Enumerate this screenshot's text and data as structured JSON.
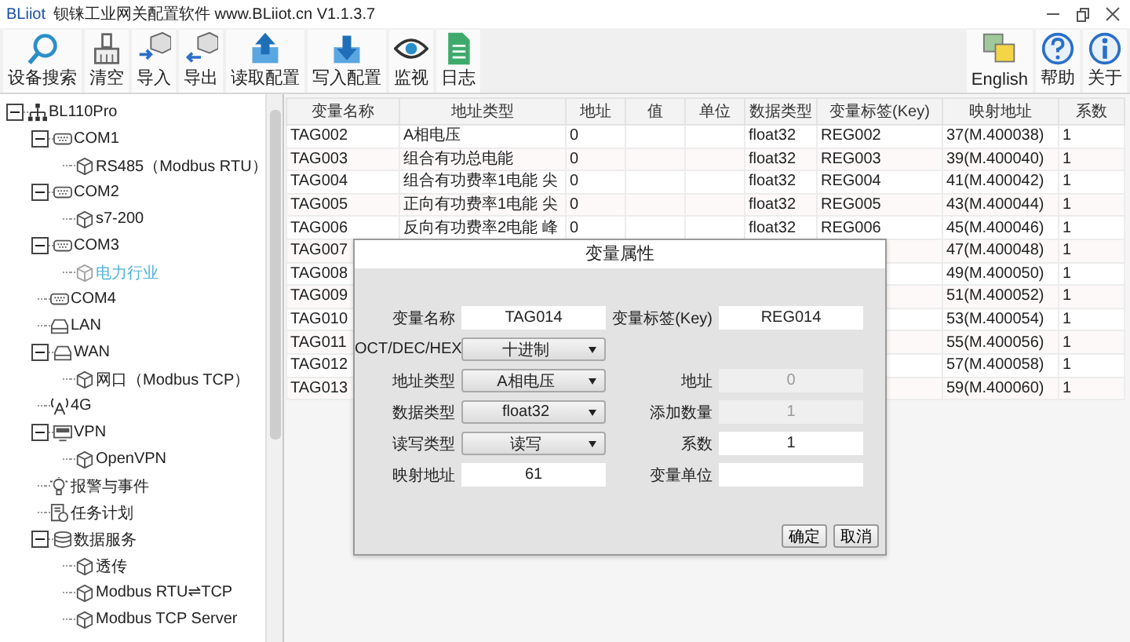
{
  "window": {
    "brand": "BLiiot",
    "title": "钡铼工业网关配置软件 www.BLiiot.cn V1.1.3.7"
  },
  "toolbar": {
    "left": [
      {
        "label": "设备搜索"
      },
      {
        "label": "清空"
      },
      {
        "label": "导入"
      },
      {
        "label": "导出"
      },
      {
        "label": "读取配置"
      },
      {
        "label": "写入配置"
      },
      {
        "label": "监视"
      },
      {
        "label": "日志"
      }
    ],
    "right": [
      {
        "label": "English"
      },
      {
        "label": "帮助"
      },
      {
        "label": "关于"
      }
    ]
  },
  "tree": [
    {
      "label": "BL110Pro",
      "kind": "root",
      "expanded": true,
      "selected": false,
      "children": [
        {
          "label": "COM1",
          "kind": "serial",
          "expanded": true,
          "selected": false,
          "children": [
            {
              "label": "RS485（Modbus RTU）",
              "kind": "protocol",
              "selected": false
            }
          ]
        },
        {
          "label": "COM2",
          "kind": "serial",
          "expanded": true,
          "selected": false,
          "children": [
            {
              "label": "s7-200",
              "kind": "protocol",
              "selected": false
            }
          ]
        },
        {
          "label": "COM3",
          "kind": "serial",
          "expanded": true,
          "selected": false,
          "children": [
            {
              "label": "电力行业",
              "kind": "protocol",
              "selected": true
            }
          ]
        },
        {
          "label": "COM4",
          "kind": "serial",
          "selected": false
        },
        {
          "label": "LAN",
          "kind": "network",
          "selected": false
        },
        {
          "label": "WAN",
          "kind": "network",
          "expanded": true,
          "selected": false,
          "children": [
            {
              "label": "网口（Modbus TCP）",
              "kind": "protocol",
              "selected": false
            }
          ]
        },
        {
          "label": "4G",
          "kind": "cellular",
          "selected": false
        },
        {
          "label": "VPN",
          "kind": "vpn",
          "expanded": true,
          "selected": false,
          "children": [
            {
              "label": "OpenVPN",
              "kind": "protocol",
              "selected": false
            }
          ]
        },
        {
          "label": "报警与事件",
          "kind": "alarm",
          "selected": false
        },
        {
          "label": "任务计划",
          "kind": "task",
          "selected": false
        },
        {
          "label": "数据服务",
          "kind": "database",
          "expanded": true,
          "selected": false,
          "children": [
            {
              "label": "透传",
              "kind": "protocol",
              "selected": false
            },
            {
              "label": "Modbus RTU⇌TCP",
              "kind": "protocol",
              "selected": false
            },
            {
              "label": "Modbus TCP Server",
              "kind": "protocol",
              "selected": false
            }
          ]
        }
      ]
    }
  ],
  "table": {
    "columns": [
      "变量名称",
      "地址类型",
      "地址",
      "值",
      "单位",
      "数据类型",
      "变量标签(Key)",
      "映射地址",
      "系数"
    ],
    "rows": [
      {
        "name": "TAG002",
        "address_type": "A相电压",
        "address": "0",
        "data_type": "float32",
        "key": "REG002",
        "mapped_address": "37(M.400038)",
        "coefficient": "1"
      },
      {
        "name": "TAG003",
        "address_type": "组合有功总电能",
        "address": "0",
        "data_type": "float32",
        "key": "REG003",
        "mapped_address": "39(M.400040)",
        "coefficient": "1"
      },
      {
        "name": "TAG004",
        "address_type": "组合有功费率1电能 尖",
        "address": "0",
        "data_type": "float32",
        "key": "REG004",
        "mapped_address": "41(M.400042)",
        "coefficient": "1"
      },
      {
        "name": "TAG005",
        "address_type": "正向有功费率1电能 尖",
        "address": "0",
        "data_type": "float32",
        "key": "REG005",
        "mapped_address": "43(M.400044)",
        "coefficient": "1"
      },
      {
        "name": "TAG006",
        "address_type": "反向有功费率2电能 峰",
        "address": "0",
        "data_type": "float32",
        "key": "REG006",
        "mapped_address": "45(M.400046)",
        "coefficient": "1"
      },
      {
        "name": "TAG007",
        "mapped_address": "47(M.400048)",
        "coefficient": "1"
      },
      {
        "name": "TAG008",
        "mapped_address": "49(M.400050)",
        "coefficient": "1"
      },
      {
        "name": "TAG009",
        "mapped_address": "51(M.400052)",
        "coefficient": "1"
      },
      {
        "name": "TAG010",
        "mapped_address": "53(M.400054)",
        "coefficient": "1"
      },
      {
        "name": "TAG011",
        "mapped_address": "55(M.400056)",
        "coefficient": "1"
      },
      {
        "name": "TAG012",
        "mapped_address": "57(M.400058)",
        "coefficient": "1"
      },
      {
        "name": "TAG013",
        "mapped_address": "59(M.400060)",
        "coefficient": "1"
      }
    ]
  },
  "dialog": {
    "title": "变量属性",
    "rows": [
      {
        "left": {
          "label": "变量名称",
          "kind": "input",
          "value": "TAG014",
          "disabled": false
        },
        "right": {
          "label": "变量标签(Key)",
          "kind": "input",
          "value": "REG014",
          "disabled": false
        }
      },
      {
        "left": {
          "label": "OCT/DEC/HEX",
          "kind": "select",
          "value": "十进制",
          "disabled": false
        }
      },
      {
        "left": {
          "label": "地址类型",
          "kind": "select",
          "value": "A相电压",
          "disabled": false
        },
        "right": {
          "label": "地址",
          "kind": "input",
          "value": "0",
          "disabled": true
        }
      },
      {
        "left": {
          "label": "数据类型",
          "kind": "select",
          "value": "float32",
          "disabled": false
        },
        "right": {
          "label": "添加数量",
          "kind": "input",
          "value": "1",
          "disabled": true
        }
      },
      {
        "left": {
          "label": "读写类型",
          "kind": "select",
          "value": "读写",
          "disabled": false
        },
        "right": {
          "label": "系数",
          "kind": "input",
          "value": "1",
          "disabled": false
        }
      },
      {
        "left": {
          "label": "映射地址",
          "kind": "input",
          "value": "61",
          "disabled": false
        },
        "right": {
          "label": "变量单位",
          "kind": "input",
          "disabled": false
        }
      }
    ],
    "buttons": [
      "确定",
      "取消"
    ]
  }
}
